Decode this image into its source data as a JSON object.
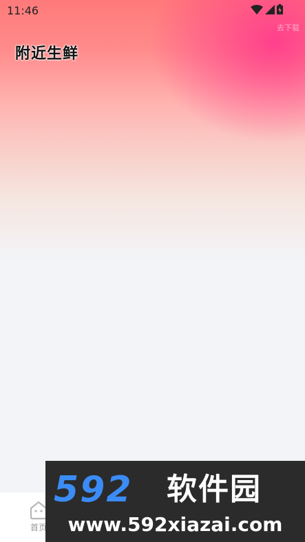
{
  "status_bar": {
    "time": "11:46",
    "icons": [
      "wifi-icon",
      "signal-icon",
      "battery-icon"
    ]
  },
  "header": {
    "title": "附近生鲜",
    "faint_text": "去下载"
  },
  "tab_bar": {
    "items": [
      {
        "label": "首页",
        "icon": "home-icon",
        "active": false
      }
    ]
  },
  "watermark": {
    "brand_number": "592",
    "brand_name": "软件园",
    "url": "www.592xiazai.com",
    "number_color": "#3b8cf5"
  },
  "colors": {
    "hero_pink": "#ff3c8c",
    "hero_coral": "#ff7a7a",
    "page_bg": "#f3f4f8"
  }
}
